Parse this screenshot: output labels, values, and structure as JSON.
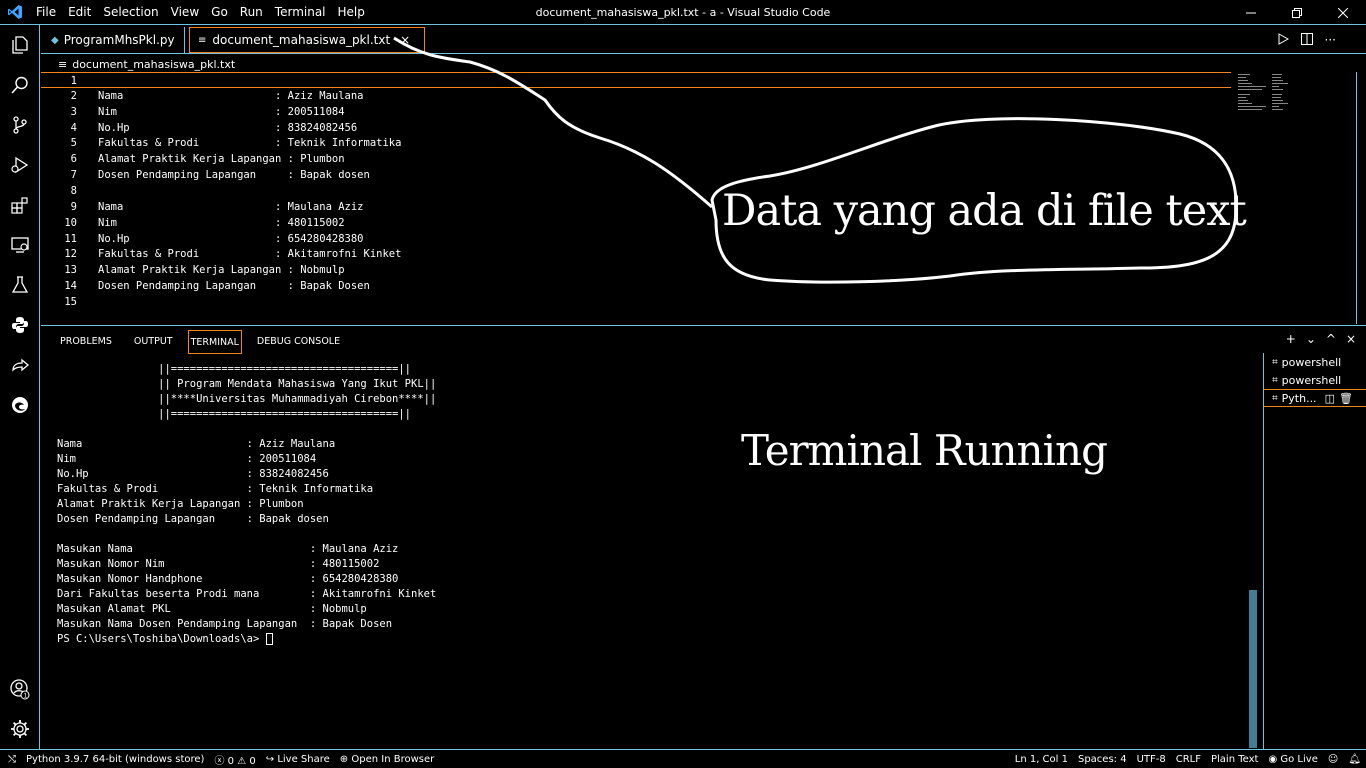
{
  "titlebar": {
    "menu": [
      "File",
      "Edit",
      "Selection",
      "View",
      "Go",
      "Run",
      "Terminal",
      "Help"
    ],
    "title": "document_mahasiswa_pkl.txt - a - Visual Studio Code"
  },
  "tabs": [
    {
      "label": "ProgramMhsPkl.py"
    },
    {
      "label": "document_mahasiswa_pkl.txt",
      "close": "×"
    }
  ],
  "breadcrumb": "document_mahasiswa_pkl.txt",
  "editor": {
    "lines": [
      {
        "n": "1",
        "text": ""
      },
      {
        "n": "2",
        "text": "Nama                        : Aziz Maulana"
      },
      {
        "n": "3",
        "text": "Nim                         : 200511084"
      },
      {
        "n": "4",
        "text": "No.Hp                       : 83824082456"
      },
      {
        "n": "5",
        "text": "Fakultas & Prodi            : Teknik Informatika"
      },
      {
        "n": "6",
        "text": "Alamat Praktik Kerja Lapangan : Plumbon"
      },
      {
        "n": "7",
        "text": "Dosen Pendamping Lapangan     : Bapak dosen"
      },
      {
        "n": "8",
        "text": ""
      },
      {
        "n": "9",
        "text": "Nama                        : Maulana Aziz"
      },
      {
        "n": "10",
        "text": "Nim                         : 480115002"
      },
      {
        "n": "11",
        "text": "No.Hp                       : 654280428380"
      },
      {
        "n": "12",
        "text": "Fakultas & Prodi            : Akitamrofni Kinket"
      },
      {
        "n": "13",
        "text": "Alamat Praktik Kerja Lapangan : Nobmulp"
      },
      {
        "n": "14",
        "text": "Dosen Pendamping Lapangan     : Bapak Dosen"
      },
      {
        "n": "15",
        "text": ""
      }
    ]
  },
  "panel": {
    "tabs": [
      "PROBLEMS",
      "OUTPUT",
      "TERMINAL",
      "DEBUG CONSOLE"
    ],
    "actions": {
      "add": "+",
      "dropdown": "⌄",
      "maximize": "^",
      "close": "×"
    },
    "terminal_lines": [
      "                ||====================================||",
      "                || Program Mendata Mahasiswa Yang Ikut PKL||",
      "                ||****Universitas Muhammadiyah Cirebon****||",
      "                ||====================================||",
      "",
      "Nama                          : Aziz Maulana",
      "Nim                           : 200511084",
      "No.Hp                         : 83824082456",
      "Fakultas & Prodi              : Teknik Informatika",
      "Alamat Praktik Kerja Lapangan : Plumbon",
      "Dosen Pendamping Lapangan     : Bapak dosen",
      "",
      "Masukan Nama                            : Maulana Aziz",
      "Masukan Nomor Nim                       : 480115002",
      "Masukan Nomor Handphone                 : 654280428380",
      "Dari Fakultas beserta Prodi mana        : Akitamrofni Kinket",
      "Masukan Alamat PKL                      : Nobmulp",
      "Masukan Nama Dosen Pendamping Lapangan  : Bapak Dosen"
    ],
    "prompt": "PS C:\\Users\\Toshiba\\Downloads\\a> ",
    "terminal_list": [
      "powershell",
      "powershell",
      "Pyth..."
    ]
  },
  "statusbar": {
    "left": [
      "Python 3.9.7 64-bit (windows store)",
      "0",
      "0",
      "Live Share",
      "Open In Browser"
    ],
    "right": [
      "Ln 1, Col 1",
      "Spaces: 4",
      "UTF-8",
      "CRLF",
      "Plain Text",
      "Go Live"
    ]
  },
  "annotations": {
    "editor_note": "Data yang ada di file text",
    "terminal_note": "Terminal Running"
  }
}
